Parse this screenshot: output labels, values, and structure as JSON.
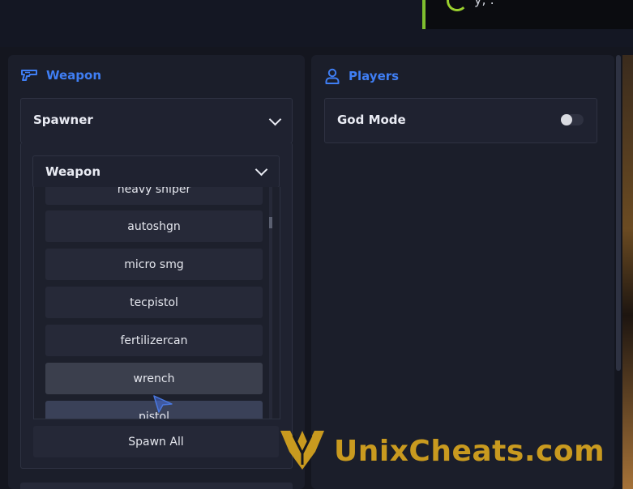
{
  "top_overlay": {
    "text": "y, ."
  },
  "left_panel": {
    "section_title": "Weapon",
    "spawner": {
      "title": "Spawner"
    },
    "weapon_dropdown": {
      "title": "Weapon"
    },
    "weapon_list": [
      "heavy sniper",
      "autoshgn",
      "micro smg",
      "tecpistol",
      "fertilizercan",
      "wrench",
      "pistol"
    ],
    "hovered_item": "wrench",
    "active_item": "pistol",
    "spawn_all_label": "Spawn All"
  },
  "right_panel": {
    "section_title": "Players",
    "god_mode": {
      "label": "God Mode",
      "enabled": false
    }
  },
  "watermark": {
    "text": "UnixCheats.com"
  },
  "colors": {
    "accent": "#3f7ef4",
    "watermark": "#c99a1f",
    "panel_bg": "#1b1e2a"
  },
  "icons": [
    "gun-icon",
    "user-icon",
    "chevron-down-icon",
    "unixcheats-logo",
    "mouse-cursor-icon"
  ]
}
